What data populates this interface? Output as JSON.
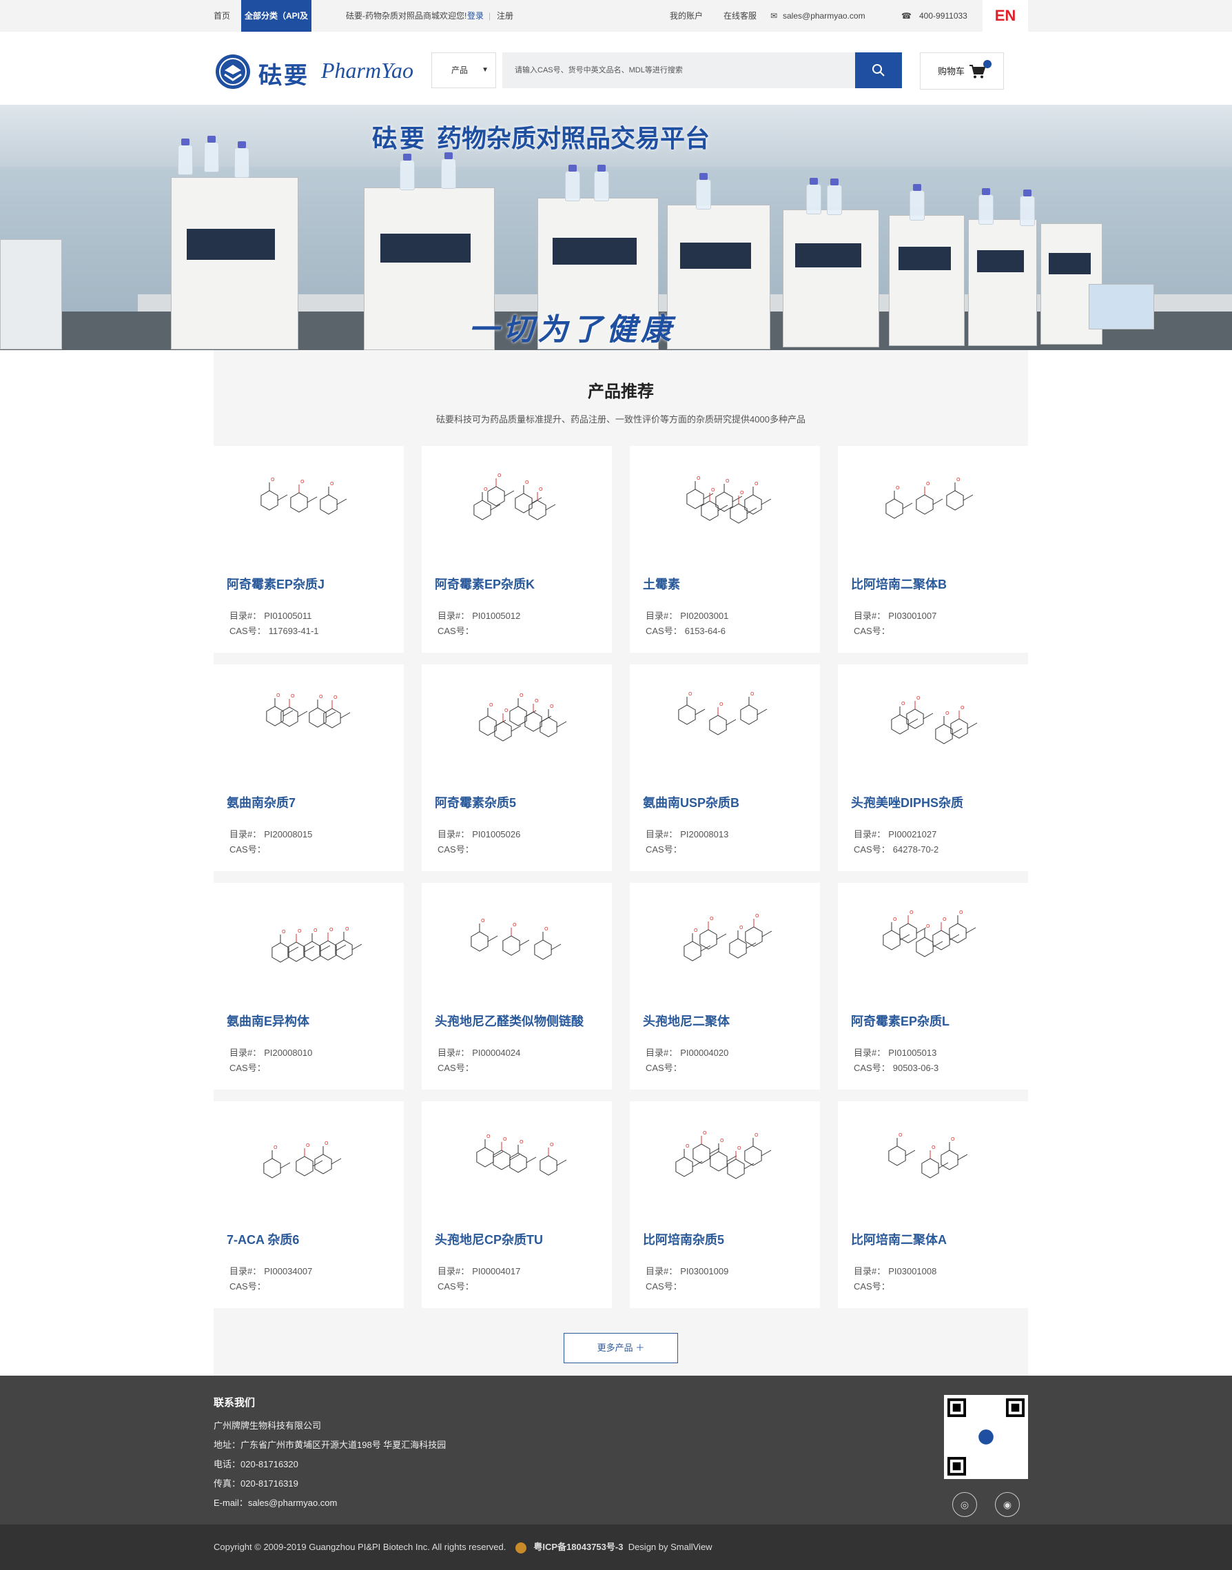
{
  "topbar": {
    "home": "首页",
    "all_categories": "全部分类（API及其杂质）",
    "welcome": "砝要-药物杂质对照品商城欢迎您!",
    "login": "登录",
    "register": "注册",
    "my_account": "我的账户",
    "online_service": "在线客服",
    "email": "sales@pharmyao.com",
    "phone": "400-9911033",
    "lang": "EN"
  },
  "header": {
    "logo_cn": "砝要",
    "logo_en": "PharmYao",
    "select_value": "产品",
    "search_placeholder": "请输入CAS号、货号中英文品名、MDL等进行搜索",
    "cart_label": "购物车",
    "brand_color": "#1f4fa0"
  },
  "banner": {
    "brand": "砝要",
    "title": "药物杂质对照品交易平台",
    "slogan": "一切为了健康"
  },
  "section": {
    "title": "产品推荐",
    "subtitle": "砝要科技可为药品质量标准提升、药品注册、一致性评价等方面的杂质研究提供4000多种产品",
    "catalog_label": "目录#：",
    "cas_label": "CAS号：",
    "products": [
      {
        "name": "阿奇霉素EP杂质J",
        "catalog": "PI01005011",
        "cas": "117693-41-1"
      },
      {
        "name": "阿奇霉素EP杂质K",
        "catalog": "PI01005012",
        "cas": ""
      },
      {
        "name": "土霉素",
        "catalog": "PI02003001",
        "cas": "6153-64-6"
      },
      {
        "name": "比阿培南二聚体B",
        "catalog": "PI03001007",
        "cas": ""
      },
      {
        "name": "氨曲南杂质7",
        "catalog": "PI20008015",
        "cas": ""
      },
      {
        "name": "阿奇霉素杂质5",
        "catalog": "PI01005026",
        "cas": ""
      },
      {
        "name": "氨曲南USP杂质B",
        "catalog": "PI20008013",
        "cas": ""
      },
      {
        "name": "头孢美唑DIPHS杂质",
        "catalog": "PI00021027",
        "cas": "64278-70-2"
      },
      {
        "name": "氨曲南E异构体",
        "catalog": "PI20008010",
        "cas": ""
      },
      {
        "name": "头孢地尼乙醛类似物侧链酸",
        "catalog": "PI00004024",
        "cas": ""
      },
      {
        "name": "头孢地尼二聚体",
        "catalog": "PI00004020",
        "cas": ""
      },
      {
        "name": "阿奇霉素EP杂质L",
        "catalog": "PI01005013",
        "cas": "90503-06-3"
      },
      {
        "name": "7-ACA 杂质6",
        "catalog": "PI00034007",
        "cas": ""
      },
      {
        "name": "头孢地尼CP杂质TU",
        "catalog": "PI00004017",
        "cas": ""
      },
      {
        "name": "比阿培南杂质5",
        "catalog": "PI03001009",
        "cas": ""
      },
      {
        "name": "比阿培南二聚体A",
        "catalog": "PI03001008",
        "cas": ""
      }
    ],
    "more_button": "更多产品"
  },
  "footer": {
    "title": "联系我们",
    "company": "广州牌牌生物科技有限公司",
    "address": "地址：广东省广州市黄埔区开源大道198号 华夏汇海科技园",
    "tel": "电话：020-81716320",
    "fax": "传真：020-81716319",
    "email": "E-mail：sales@pharmyao.com",
    "icons": [
      "wechat-icon",
      "weibo-icon"
    ]
  },
  "copyright": {
    "text": "Copyright © 2009-2019 Guangzhou PI&PI Biotech Inc. All rights reserved.",
    "icp": "粤ICP备18043753号-3",
    "design": "Design by SmallView"
  }
}
